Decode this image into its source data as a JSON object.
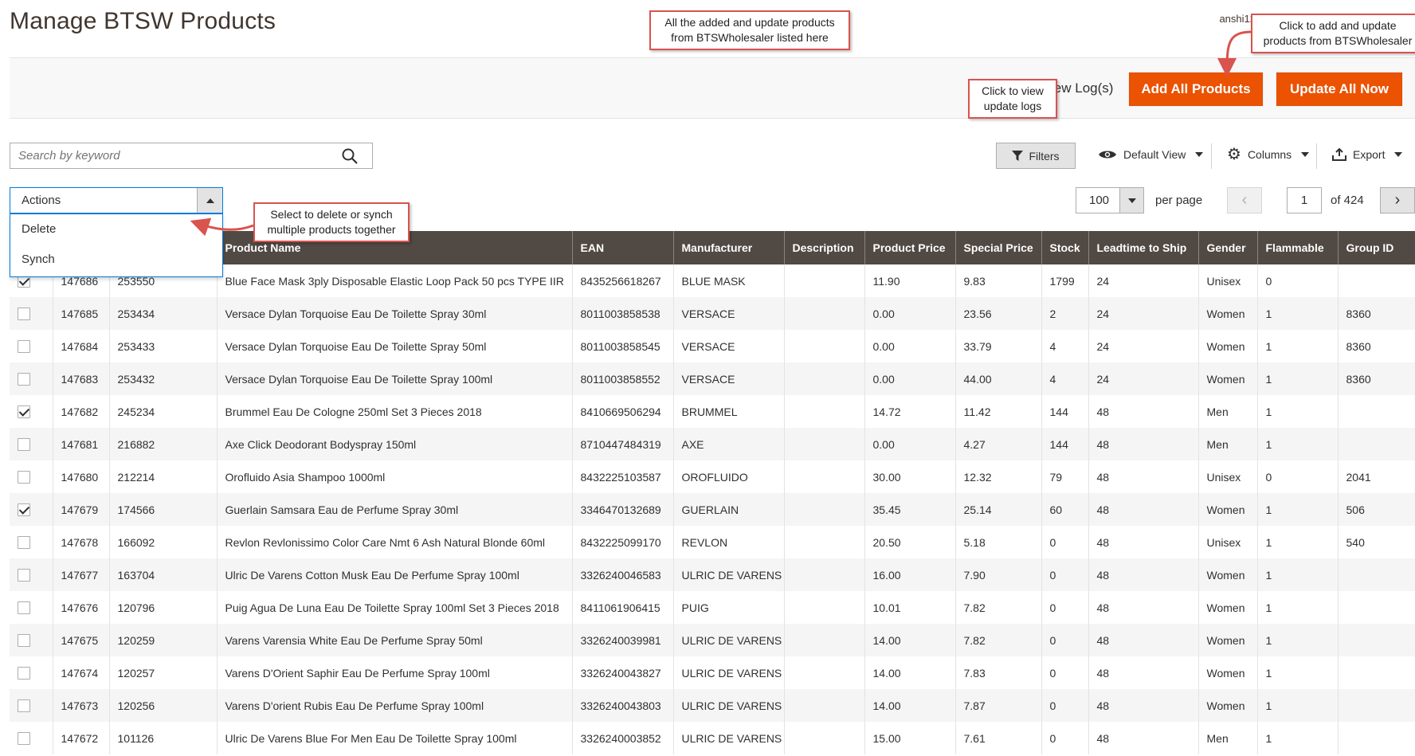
{
  "page": {
    "title": "Manage BTSW Products",
    "user_fragment": "anshi12"
  },
  "action_bar": {
    "view_logs_label": "View Log(s)",
    "add_all_label": "Add All Products",
    "update_all_label": "Update All Now",
    "accent_color": "#eb5202"
  },
  "callouts": {
    "listed_here": [
      "All the added and update products",
      "from BTSWholesaler listed here"
    ],
    "add_update": [
      "Click to add and update",
      "products from BTSWholesaler"
    ],
    "view_logs": [
      "Click to view",
      "update logs"
    ],
    "actions_hint": [
      "Select to delete or synch",
      "multiple products together"
    ]
  },
  "toolbar": {
    "search_placeholder": "Search by keyword",
    "filters_label": "Filters",
    "default_view_label": "Default View",
    "columns_label": "Columns",
    "export_label": "Export"
  },
  "mass_actions": {
    "label": "Actions",
    "options": [
      "Delete",
      "Synch"
    ]
  },
  "pager": {
    "per_page_value": "100",
    "per_page_label": "per page",
    "current_page": "1",
    "of_label": "of 424"
  },
  "grid": {
    "columns": [
      "",
      "",
      "",
      "Product Name",
      "EAN",
      "Manufacturer",
      "Description",
      "Product Price",
      "Special Price",
      "Stock",
      "Leadtime to Ship",
      "Gender",
      "Flammable",
      "Group ID"
    ],
    "rows": [
      {
        "checked": true,
        "id": "147686",
        "sku": "253550",
        "name": "Blue Face Mask 3ply Disposable Elastic Loop Pack 50 pcs TYPE IIR",
        "ean": "8435256618267",
        "manufacturer": "BLUE MASK",
        "description": "",
        "price": "11.90",
        "special": "9.83",
        "stock": "1799",
        "leadtime": "24",
        "gender": "Unisex",
        "flammable": "0",
        "group": ""
      },
      {
        "checked": false,
        "id": "147685",
        "sku": "253434",
        "name": "Versace Dylan Torquoise Eau De Toilette Spray 30ml",
        "ean": "8011003858538",
        "manufacturer": "VERSACE",
        "description": "",
        "price": "0.00",
        "special": "23.56",
        "stock": "2",
        "leadtime": "24",
        "gender": "Women",
        "flammable": "1",
        "group": "8360"
      },
      {
        "checked": false,
        "id": "147684",
        "sku": "253433",
        "name": "Versace Dylan Torquoise Eau De Toilette Spray 50ml",
        "ean": "8011003858545",
        "manufacturer": "VERSACE",
        "description": "",
        "price": "0.00",
        "special": "33.79",
        "stock": "4",
        "leadtime": "24",
        "gender": "Women",
        "flammable": "1",
        "group": "8360"
      },
      {
        "checked": false,
        "id": "147683",
        "sku": "253432",
        "name": "Versace Dylan Torquoise Eau De Toilette Spray 100ml",
        "ean": "8011003858552",
        "manufacturer": "VERSACE",
        "description": "",
        "price": "0.00",
        "special": "44.00",
        "stock": "4",
        "leadtime": "24",
        "gender": "Women",
        "flammable": "1",
        "group": "8360"
      },
      {
        "checked": true,
        "id": "147682",
        "sku": "245234",
        "name": "Brummel Eau De Cologne 250ml Set 3 Pieces 2018",
        "ean": "8410669506294",
        "manufacturer": "BRUMMEL",
        "description": "",
        "price": "14.72",
        "special": "11.42",
        "stock": "144",
        "leadtime": "48",
        "gender": "Men",
        "flammable": "1",
        "group": ""
      },
      {
        "checked": false,
        "id": "147681",
        "sku": "216882",
        "name": "Axe Click Deodorant Bodyspray 150ml",
        "ean": "8710447484319",
        "manufacturer": "AXE",
        "description": "",
        "price": "0.00",
        "special": "4.27",
        "stock": "144",
        "leadtime": "48",
        "gender": "Men",
        "flammable": "1",
        "group": ""
      },
      {
        "checked": false,
        "id": "147680",
        "sku": "212214",
        "name": "Orofluido Asia Shampoo 1000ml",
        "ean": "8432225103587",
        "manufacturer": "OROFLUIDO",
        "description": "",
        "price": "30.00",
        "special": "12.32",
        "stock": "79",
        "leadtime": "48",
        "gender": "Unisex",
        "flammable": "0",
        "group": "2041"
      },
      {
        "checked": true,
        "id": "147679",
        "sku": "174566",
        "name": "Guerlain Samsara Eau de Perfume Spray 30ml",
        "ean": "3346470132689",
        "manufacturer": "GUERLAIN",
        "description": "",
        "price": "35.45",
        "special": "25.14",
        "stock": "60",
        "leadtime": "48",
        "gender": "Women",
        "flammable": "1",
        "group": "506"
      },
      {
        "checked": false,
        "id": "147678",
        "sku": "166092",
        "name": "Revlon Revlonissimo Color Care Nmt 6 Ash Natural Blonde 60ml",
        "ean": "8432225099170",
        "manufacturer": "REVLON",
        "description": "",
        "price": "20.50",
        "special": "5.18",
        "stock": "0",
        "leadtime": "48",
        "gender": "Unisex",
        "flammable": "1",
        "group": "540"
      },
      {
        "checked": false,
        "id": "147677",
        "sku": "163704",
        "name": "Ulric De Varens Cotton Musk Eau De Perfume Spray 100ml",
        "ean": "3326240046583",
        "manufacturer": "ULRIC DE VARENS",
        "description": "",
        "price": "16.00",
        "special": "7.90",
        "stock": "0",
        "leadtime": "48",
        "gender": "Women",
        "flammable": "1",
        "group": ""
      },
      {
        "checked": false,
        "id": "147676",
        "sku": "120796",
        "name": "Puig Agua De Luna Eau De Toilette Spray 100ml Set 3 Pieces 2018",
        "ean": "8411061906415",
        "manufacturer": "PUIG",
        "description": "",
        "price": "10.01",
        "special": "7.82",
        "stock": "0",
        "leadtime": "48",
        "gender": "Women",
        "flammable": "1",
        "group": ""
      },
      {
        "checked": false,
        "id": "147675",
        "sku": "120259",
        "name": "Varens Varensia White Eau De Perfume Spray 50ml",
        "ean": "3326240039981",
        "manufacturer": "ULRIC DE VARENS",
        "description": "",
        "price": "14.00",
        "special": "7.82",
        "stock": "0",
        "leadtime": "48",
        "gender": "Women",
        "flammable": "1",
        "group": ""
      },
      {
        "checked": false,
        "id": "147674",
        "sku": "120257",
        "name": "Varens D'Orient Saphir Eau De Perfume Spray 100ml",
        "ean": "3326240043827",
        "manufacturer": "ULRIC DE VARENS",
        "description": "",
        "price": "14.00",
        "special": "7.83",
        "stock": "0",
        "leadtime": "48",
        "gender": "Women",
        "flammable": "1",
        "group": ""
      },
      {
        "checked": false,
        "id": "147673",
        "sku": "120256",
        "name": "Varens D'orient Rubis Eau De Perfume Spray 100ml",
        "ean": "3326240043803",
        "manufacturer": "ULRIC DE VARENS",
        "description": "",
        "price": "14.00",
        "special": "7.87",
        "stock": "0",
        "leadtime": "48",
        "gender": "Women",
        "flammable": "1",
        "group": ""
      },
      {
        "checked": false,
        "id": "147672",
        "sku": "101126",
        "name": "Ulric De Varens Blue For Men Eau De Toilette Spray 100ml",
        "ean": "3326240003852",
        "manufacturer": "ULRIC DE VARENS",
        "description": "",
        "price": "15.00",
        "special": "7.61",
        "stock": "0",
        "leadtime": "48",
        "gender": "Men",
        "flammable": "1",
        "group": ""
      }
    ]
  }
}
